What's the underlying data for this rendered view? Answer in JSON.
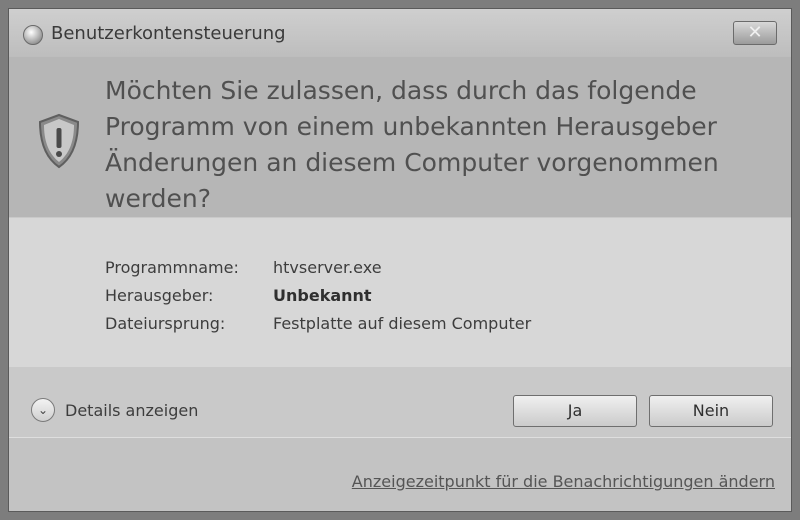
{
  "window": {
    "title": "Benutzerkontensteuerung",
    "close_symbol": "✕"
  },
  "header": {
    "question": "Möchten Sie zulassen, dass durch das folgende Programm von einem unbekannten Herausgeber Änderungen an diesem Computer vorgenommen werden?",
    "icon": "shield-warning-icon"
  },
  "info": {
    "rows": [
      {
        "label": "Programmname:",
        "value": "htvserver.exe"
      },
      {
        "label": "Herausgeber:",
        "value": "Unbekannt"
      },
      {
        "label": "Dateiursprung:",
        "value": "Festplatte auf diesem Computer"
      }
    ]
  },
  "actions": {
    "details_label": "Details anzeigen",
    "yes_label": "Ja",
    "no_label": "Nein"
  },
  "footer": {
    "link_text": "Anzeigezeitpunkt für die Benachrichtigungen ändern"
  }
}
